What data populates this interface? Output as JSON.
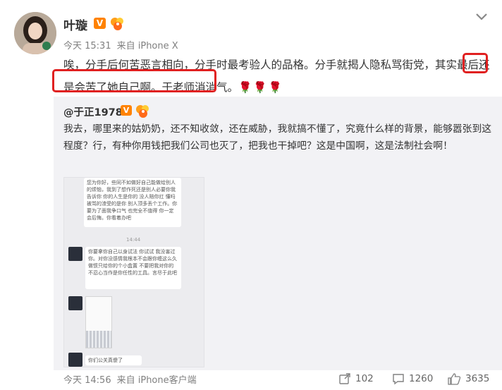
{
  "post": {
    "author": "叶璇",
    "verified_badge": "V",
    "time": "今天 15:31",
    "source": "来自 iPhone X",
    "text_before": "唉，分手后何苦恶言相向，分手时最考验人的品格。分手就揭人隐私骂街党，",
    "text_highlight1": "其",
    "text_highlight2": "实最后还是会苦了她自己啊。",
    "text_after": "于老师消消气。",
    "emoji": "🌹🌹🌹",
    "highlight_color": "#e02020"
  },
  "repost": {
    "author": "@于正1978",
    "verified_badge": "V",
    "text": "我去，哪里来的姑奶奶，还不知收敛，还在威胁，我就搞不懂了，究竟什么样的背景，能够嚣张到这程度？行，有种你用钱把我们公司也灭了，把我也干掉吧？这是中国啊，这是法制社会啊！",
    "screenshot": {
      "bubble1": "您为你好，些同不如做好自己能做给别人的烦恼，我到了想作死还是别人必要你我告诉你 你的人生是你的 没人陪你扛 懂吗 被骂的渣受的是你 别人顶多丢个工作。你要为了面我争口气 也完全不值得 你一定会后悔。你看着办吧",
      "time": "14:44",
      "bubble2": "你要拿你自己以身试法 你试试 我没害过你。对你没感情我根本不会跟你缠这么久 做惯只给你的个小盒置 不要把我对你的不忍心当作是你任性的工具。言尽于此吧",
      "bubble3": "你们公关真傻了"
    }
  },
  "footer": {
    "time": "今天 14:56",
    "source": "来自 iPhone客户端",
    "shares": "102",
    "comments": "1260",
    "likes": "3635"
  },
  "colors": {
    "badge": "#ff8200",
    "repost_bg": "#f2f2f5",
    "muted": "#808080"
  },
  "icons": [
    "avatar",
    "verified-v-icon",
    "vip-icon",
    "chevron-down-icon",
    "share-icon",
    "comment-icon",
    "like-icon"
  ]
}
